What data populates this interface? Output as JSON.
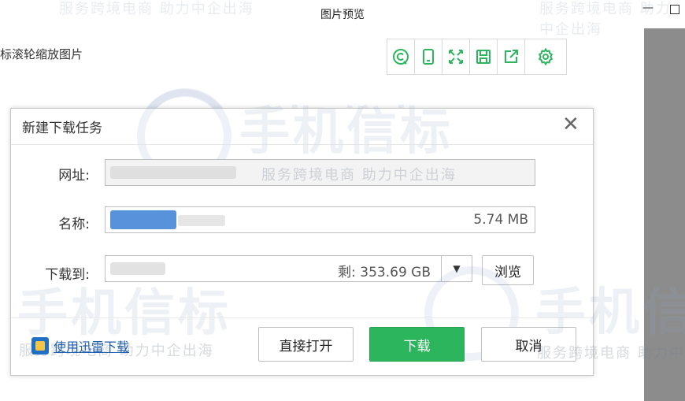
{
  "window": {
    "title": "图片预览",
    "minimize_glyph": "—",
    "hint": "标滚轮缩放图片"
  },
  "watermark": {
    "brand": "手机信标",
    "slogan": "服务跨境电商 助力中企出海"
  },
  "toolbar": {
    "buttons": [
      {
        "name": "copyright-icon"
      },
      {
        "name": "phone-icon"
      },
      {
        "name": "fullscreen-icon"
      },
      {
        "name": "save-icon"
      },
      {
        "name": "share-icon"
      },
      {
        "name": "settings-icon"
      }
    ]
  },
  "dialog": {
    "title": "新建下载任务",
    "close_glyph": "✕",
    "url_label": "网址:",
    "url_value": "",
    "name_label": "名称:",
    "file_size": "5.74 MB",
    "save_to_label": "下载到:",
    "free_space": "剩: 353.69 GB",
    "dropdown_glyph": "▼",
    "browse_label": "浏览",
    "thunder_link": "使用迅雷下载",
    "open_direct_label": "直接打开",
    "download_label": "下载",
    "cancel_label": "取消",
    "colors": {
      "primary": "#2db55d",
      "link": "#1f5fb0"
    }
  }
}
